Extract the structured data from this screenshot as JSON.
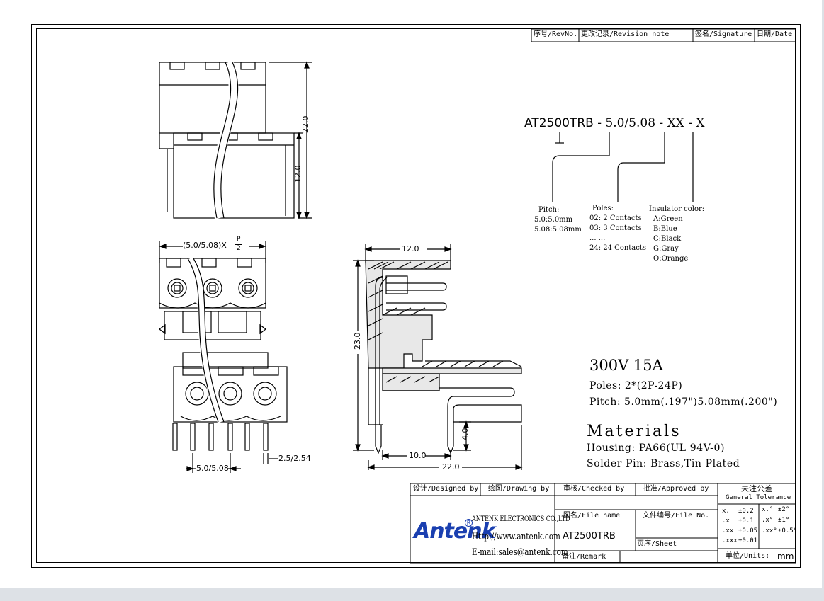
{
  "revision_header": {
    "rev_no": "序号/RevNo.",
    "revision_note": "更改记录/Revision note",
    "signature": "签名/Signature",
    "date": "日期/Date"
  },
  "part_code": {
    "prefix": "AT2500TRB",
    "pitch_seg": "5.0/5.08",
    "poles_seg": "XX",
    "color_seg": "X",
    "dash": "-"
  },
  "pitch_legend": [
    "Pitch:",
    "5.0:5.0mm",
    "5.08:5.08mm"
  ],
  "poles_legend": [
    "Poles:",
    "02: 2 Contacts",
    "03: 3 Contacts",
    "... ...",
    "24: 24 Contacts"
  ],
  "color_legend": [
    "Insulator color:",
    "A:Green",
    "B:Blue",
    "C:Black",
    "G:Gray",
    "O:Orange"
  ],
  "dimensions": {
    "top_height_total": "22.0",
    "top_height_lower": "12.0",
    "front_pitch_label": "(5.0/5.08)X",
    "front_pitch_frac_top": "P",
    "front_pitch_frac_bottom": "2",
    "front_pitch_bottom": "5.0/5.08",
    "front_pin_spacing": "2.5/2.54",
    "side_width_top": "12.0",
    "side_height": "23.0",
    "side_pin_len": "4.0",
    "side_offset": "10.0",
    "side_width_bottom": "22.0"
  },
  "specs": {
    "rating": "300V 15A",
    "poles": "Poles: 2*(2P-24P)",
    "pitch": "Pitch:  5.0mm(.197\")5.08mm(.200\")"
  },
  "materials": {
    "title": "Materials",
    "housing": "Housing: PA66(UL 94V-0)",
    "solder_pin": "Solder Pin: Brass,Tin Plated"
  },
  "title_block": {
    "designed_by": "设计/Designed by",
    "drawing_by": "绘图/Drawing by",
    "checked_by": "审核/Checked by",
    "approved_by": "批准/Approved by",
    "general_tolerance_cn": "未注公差",
    "general_tolerance_en": "General Tolerance",
    "file_name_label": "图名/File name",
    "file_name_value": "AT2500TRB",
    "file_no_label": "文件编号/File No.",
    "sheet_label": "页序/Sheet",
    "remark_label": "备注/Remark",
    "units_label": "单位/Units:",
    "units_value": "mm",
    "company": "ANTENK ELECTRONICS CO.,LTD",
    "website": "Http://www.antenk.com",
    "email": "E-mail:sales@antenk.com",
    "logo_text": "Antenk",
    "logo_mark": "R"
  },
  "tolerance": {
    "linear": [
      {
        "key": "x.",
        "val": "±0.2"
      },
      {
        "key": ".x",
        "val": "±0.1"
      },
      {
        "key": ".xx",
        "val": "±0.05"
      },
      {
        "key": ".xxx",
        "val": "±0.01"
      }
    ],
    "angular": [
      {
        "key": "x.°",
        "val": "±2°"
      },
      {
        "key": ".x°",
        "val": "±1°"
      },
      {
        "key": ".xx°",
        "val": "±0.5°"
      }
    ]
  }
}
